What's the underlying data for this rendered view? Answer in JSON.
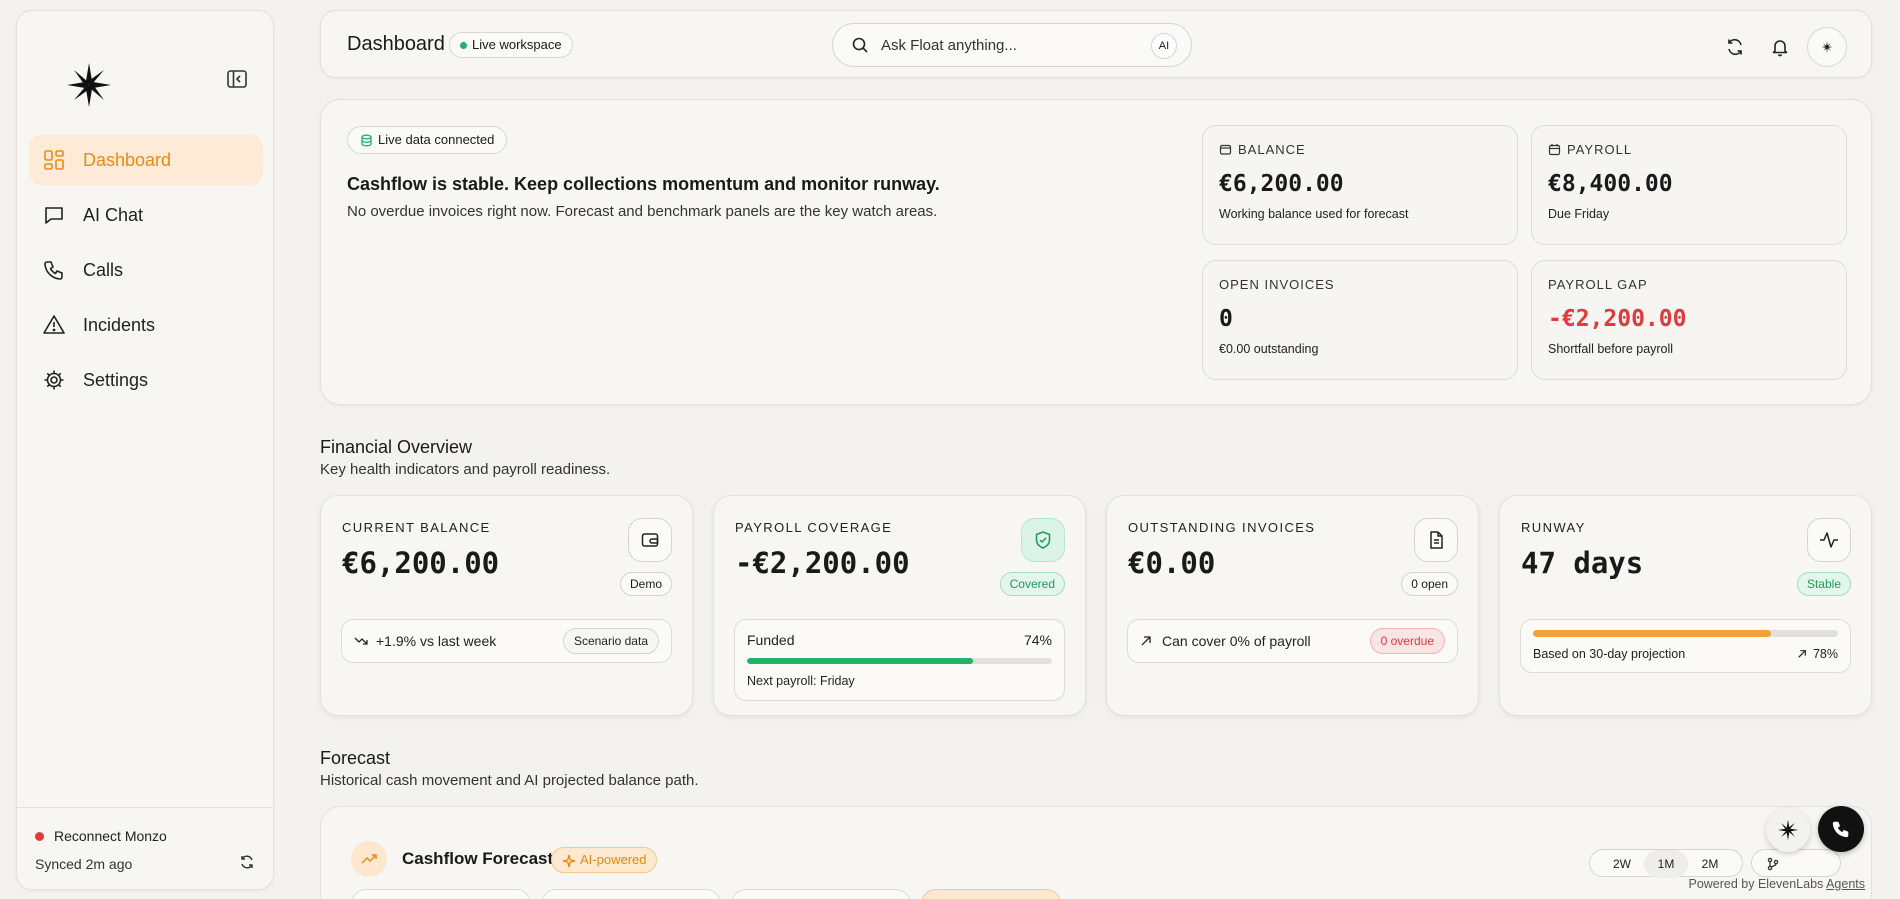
{
  "sidebar": {
    "items": [
      {
        "label": "Dashboard",
        "icon": "dashboard-grid-icon",
        "active": true
      },
      {
        "label": "AI Chat",
        "icon": "chat-icon"
      },
      {
        "label": "Calls",
        "icon": "phone-icon"
      },
      {
        "label": "Incidents",
        "icon": "warning-icon"
      },
      {
        "label": "Settings",
        "icon": "gear-icon"
      }
    ],
    "footer": {
      "reconnect": "Reconnect Monzo",
      "synced": "Synced 2m ago"
    }
  },
  "topbar": {
    "title": "Dashboard",
    "workspace_badge": "Live workspace",
    "search_placeholder": "Ask Float anything...",
    "ai_pill": "AI"
  },
  "hero": {
    "live_badge": "Live data connected",
    "headline": "Cashflow is stable. Keep collections momentum and monitor runway.",
    "subtext": "No overdue invoices right now. Forecast and benchmark panels are the key watch areas.",
    "stats": [
      {
        "label": "BALANCE",
        "value": "€6,200.00",
        "sub": "Working balance used for forecast",
        "icon": "wallet-icon"
      },
      {
        "label": "PAYROLL",
        "value": "€8,400.00",
        "sub": "Due Friday",
        "icon": "calendar-icon"
      },
      {
        "label": "OPEN INVOICES",
        "value": "0",
        "sub": "€0.00 outstanding"
      },
      {
        "label": "PAYROLL GAP",
        "value": "-€2,200.00",
        "sub": "Shortfall before payroll",
        "negative_color": "#e03b3b"
      }
    ]
  },
  "financial_overview": {
    "title": "Financial Overview",
    "subtitle": "Key health indicators and payroll readiness."
  },
  "kpis": {
    "balance": {
      "label": "CURRENT BALANCE",
      "value": "€6,200.00",
      "tag": "Demo",
      "trend": "+1.9% vs last week",
      "pill": "Scenario data"
    },
    "payroll": {
      "label": "PAYROLL COVERAGE",
      "value": "-€2,200.00",
      "tag": "Covered",
      "funded_label": "Funded",
      "funded_pct": "74%",
      "funded_fraction": 0.74,
      "next": "Next payroll: Friday",
      "accent": "#22b36b"
    },
    "invoices": {
      "label": "OUTSTANDING INVOICES",
      "value": "€0.00",
      "tag": "0 open",
      "cover_text": "Can cover 0% of payroll",
      "overdue": "0 overdue"
    },
    "runway": {
      "label": "RUNWAY",
      "value": "47 days",
      "tag": "Stable",
      "projection": "Based on 30-day projection",
      "pct": "78%",
      "fraction": 0.78,
      "accent": "#f0a437"
    }
  },
  "forecast_section": {
    "title": "Forecast",
    "subtitle": "Historical cash movement and AI projected balance path."
  },
  "forecast_card": {
    "title": "Cashflow Forecast",
    "ai_badge": "AI-powered",
    "ranges": [
      "2W",
      "1M",
      "2M"
    ]
  },
  "powered_by": {
    "prefix": "Powered by ElevenLabs ",
    "link": "Agents"
  }
}
